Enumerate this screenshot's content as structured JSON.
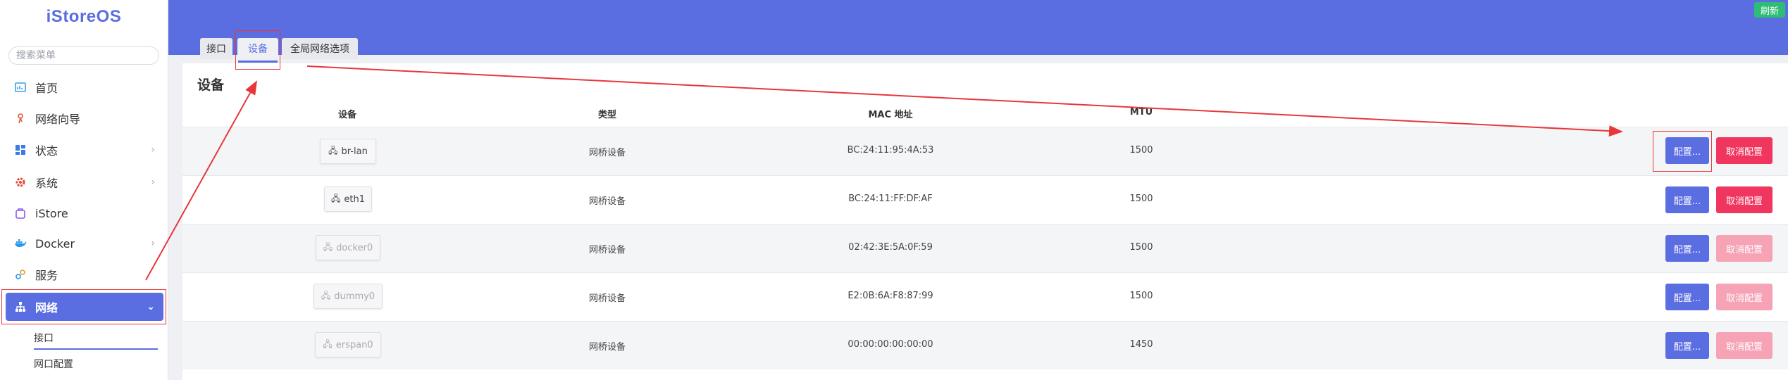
{
  "sidebar": {
    "logo": "iStoreOS",
    "search_placeholder": "搜索菜单",
    "items": [
      {
        "label": "首页",
        "icon": "home-dashboard-icon"
      },
      {
        "label": "网络向导",
        "icon": "network-wizard-icon"
      },
      {
        "label": "状态",
        "icon": "status-grid-icon",
        "chevron": "›"
      },
      {
        "label": "系统",
        "icon": "system-gear-icon",
        "chevron": "›"
      },
      {
        "label": "iStore",
        "icon": "istore-icon"
      },
      {
        "label": "Docker",
        "icon": "docker-icon",
        "chevron": "›"
      },
      {
        "label": "服务",
        "icon": "services-link-icon"
      },
      {
        "label": "网络",
        "icon": "network-tree-icon",
        "chevron": "⌄"
      }
    ],
    "sub_items": [
      {
        "label": "接口"
      },
      {
        "label": "网口配置"
      }
    ]
  },
  "header": {
    "refresh_label": "刷新"
  },
  "tabs": [
    {
      "label": "接口",
      "active": false
    },
    {
      "label": "设备",
      "active": true
    },
    {
      "label": "全局网络选项",
      "active": false
    }
  ],
  "section": {
    "title": "设备",
    "columns": [
      "设备",
      "类型",
      "MAC 地址",
      "MTU"
    ]
  },
  "devices": [
    {
      "name": "br-lan",
      "type": "网桥设备",
      "mac": "BC:24:11:95:4A:53",
      "mtu": "1500",
      "configure": "配置...",
      "unconfigure": "取消配置",
      "enabled": true
    },
    {
      "name": "eth1",
      "type": "网桥设备",
      "mac": "BC:24:11:FF:DF:AF",
      "mtu": "1500",
      "configure": "配置...",
      "unconfigure": "取消配置",
      "enabled": true
    },
    {
      "name": "docker0",
      "type": "网桥设备",
      "mac": "02:42:3E:5A:0F:59",
      "mtu": "1500",
      "configure": "配置...",
      "unconfigure": "取消配置",
      "enabled": false
    },
    {
      "name": "dummy0",
      "type": "网桥设备",
      "mac": "E2:0B:6A:F8:87:99",
      "mtu": "1500",
      "configure": "配置...",
      "unconfigure": "取消配置",
      "enabled": false
    },
    {
      "name": "erspan0",
      "type": "网桥设备",
      "mac": "00:00:00:00:00:00",
      "mtu": "1450",
      "configure": "配置...",
      "unconfigure": "取消配置",
      "enabled": false
    }
  ],
  "colors": {
    "accent": "#5b6ee1",
    "danger": "#f0365f",
    "danger_disabled": "#f6a3b5",
    "refresh": "#2dbd76",
    "annotation": "#e8373b"
  }
}
